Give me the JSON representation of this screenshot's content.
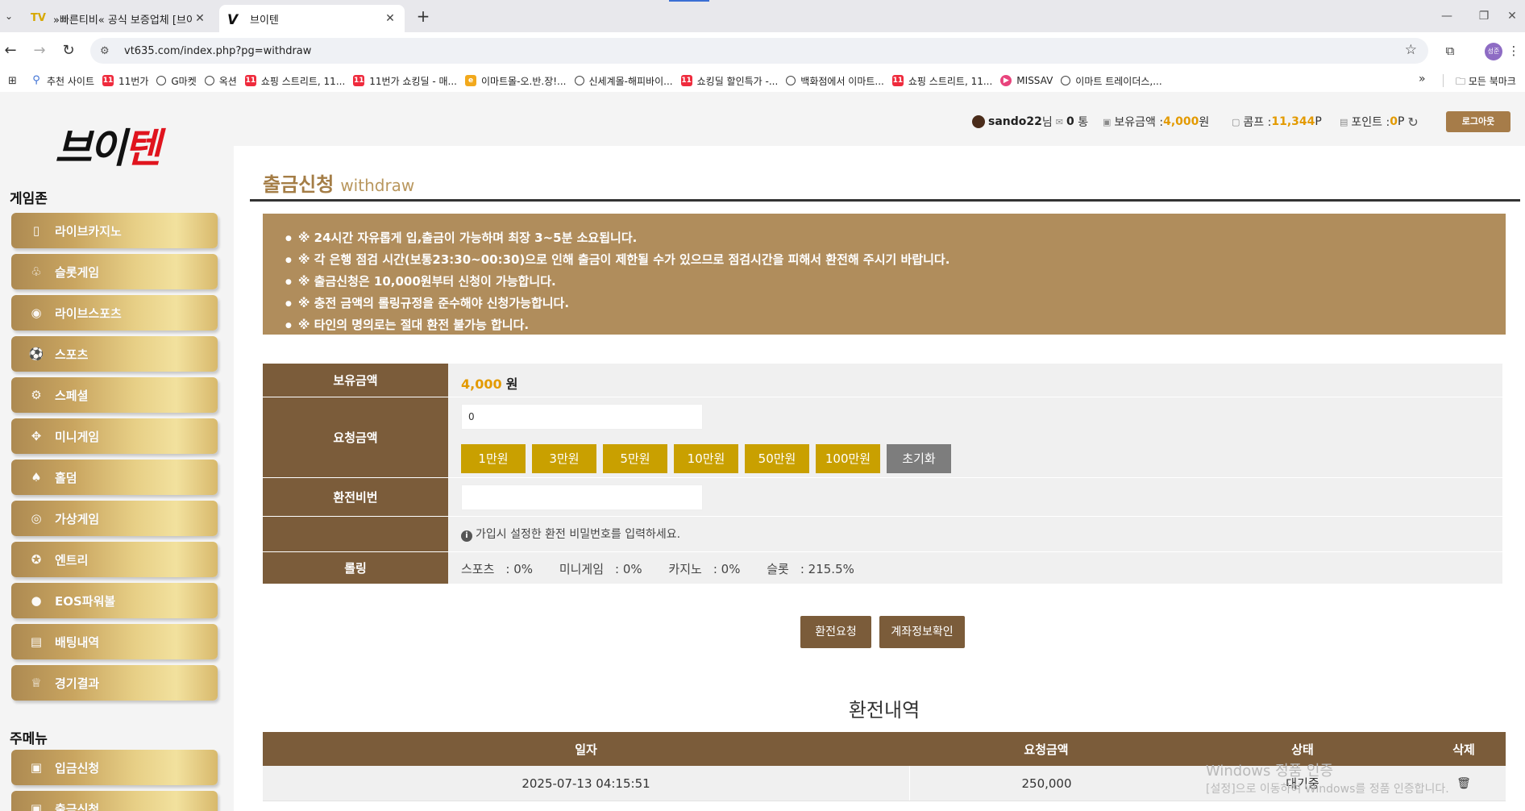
{
  "browser": {
    "tabs": [
      {
        "icon_text": "TV",
        "title": "»빠른티비« 공식 보증업체 [브이",
        "close": "✕"
      },
      {
        "icon_text": "V",
        "title": "브이텐",
        "close": "✕"
      }
    ],
    "new_tab": "+",
    "url": "vt635.com/index.php?pg=withdraw",
    "profile_initials": "성준",
    "bookmarks": [
      {
        "icon": "search-icon",
        "label": "추천 사이트"
      },
      {
        "icon": "11st-icon",
        "icon_text": "11",
        "label": "11번가"
      },
      {
        "icon": "globe-icon",
        "label": "G마켓"
      },
      {
        "icon": "globe-icon",
        "label": "옥션"
      },
      {
        "icon": "11st-icon",
        "icon_text": "11",
        "label": "쇼핑 스트리트, 11..."
      },
      {
        "icon": "11st-icon",
        "icon_text": "11",
        "label": "11번가 쇼킹딜 - 매..."
      },
      {
        "icon": "emart-icon",
        "icon_text": "e",
        "label": "이마트몰-오.반.장!..."
      },
      {
        "icon": "globe-icon",
        "label": "신세계몰-해피바이..."
      },
      {
        "icon": "11st-icon",
        "icon_text": "11",
        "label": "쇼킹딜 할인특가 -..."
      },
      {
        "icon": "globe-icon",
        "label": "백화점에서 이마트..."
      },
      {
        "icon": "11st-icon",
        "icon_text": "11",
        "label": "쇼핑 스트리트, 11..."
      },
      {
        "icon": "missav-icon",
        "icon_text": "▶",
        "label": "MISSAV"
      },
      {
        "icon": "globe-icon",
        "label": "이마트 트레이더스,..."
      }
    ],
    "bookmarks_more": "»",
    "all_bookmarks": "모든 북마크"
  },
  "site": {
    "logo_black": "브이",
    "logo_red": "텐"
  },
  "sidebar": {
    "game_zone_title": "게임존",
    "game_items": [
      {
        "icon": "card-icon",
        "label": "라이브카지노"
      },
      {
        "icon": "slot-icon",
        "label": "슬롯게임"
      },
      {
        "icon": "live-icon",
        "label": "라이브스포츠"
      },
      {
        "icon": "soccer-ball-icon",
        "label": "스포츠"
      },
      {
        "icon": "special-icon",
        "label": "스페셜"
      },
      {
        "icon": "gamepad-icon",
        "label": "미니게임"
      },
      {
        "icon": "holdem-cards-icon",
        "label": "홀덤"
      },
      {
        "icon": "vr-icon",
        "label": "가상게임"
      },
      {
        "icon": "entry-icon",
        "label": "엔트리"
      },
      {
        "icon": "eos-icon",
        "label": "EOS파워볼"
      },
      {
        "icon": "betting-icon",
        "label": "배팅내역"
      },
      {
        "icon": "trophy-icon",
        "label": "경기결과"
      }
    ],
    "main_menu_title": "주메뉴",
    "main_items": [
      {
        "icon": "deposit-icon",
        "label": "입금신청"
      },
      {
        "icon": "withdraw-icon",
        "label": "출금신청"
      }
    ]
  },
  "userbar": {
    "username": "sando22",
    "username_suffix": "님",
    "messages": "0",
    "messages_unit": "통",
    "balance_label": "보유금액 : ",
    "balance_value": "4,000",
    "balance_unit": "원",
    "comp_label": "콤프 : ",
    "comp_value": "11,344",
    "comp_unit": "P",
    "point_label": "포인트 : ",
    "point_value": "0",
    "point_unit": "P",
    "logout": "로그아웃"
  },
  "page": {
    "title": "출금신청",
    "title_en": "withdraw",
    "notices": [
      "※ 24시간 자유롭게 입,출금이 가능하며 최장 3~5분 소요됩니다.",
      "※ 각 은행 점검 시간(보통23:30~00:30)으로 인해 출금이 제한될 수가 있으므로 점검시간을 피해서 환전해 주시기 바랍니다.",
      "※ 출금신청은 10,000원부터 신청이 가능합니다.",
      "※ 충전 금액의 롤링규정을 준수해야 신청가능합니다.",
      "※ 타인의 명의로는 절대 환전 불가능 합니다."
    ],
    "form": {
      "balance_label": "보유금액",
      "balance_value": "4,000",
      "balance_unit": "원",
      "request_label": "요청금액",
      "request_value": "0",
      "amount_buttons": [
        "1만원",
        "3만원",
        "5만원",
        "10만원",
        "50만원",
        "100만원"
      ],
      "reset_button": "초기화",
      "password_label": "환전비번",
      "password_value": "",
      "password_hint": "가입시 설정한 환전 비밀번호를 입력하세요.",
      "rolling_label": "롤링",
      "rolling": [
        {
          "label": "스포츠",
          "value": "0%"
        },
        {
          "label": "미니게임",
          "value": "0%"
        },
        {
          "label": "카지노",
          "value": "0%"
        },
        {
          "label": "슬롯",
          "value": "215.5%"
        }
      ]
    },
    "submit_button": "환전요청",
    "account_button": "계좌정보확인",
    "history_title": "환전내역",
    "history_headers": {
      "date": "일자",
      "amount": "요청금액",
      "status": "상태",
      "delete": "삭제"
    },
    "history_rows": [
      {
        "date": "2025-07-13 04:15:51",
        "amount": "250,000",
        "status": "대기중"
      }
    ]
  },
  "watermark": {
    "line1": "Windows 정품 인증",
    "line2": "[설정]으로 이동하여 Windows를 정품 인증합니다."
  }
}
